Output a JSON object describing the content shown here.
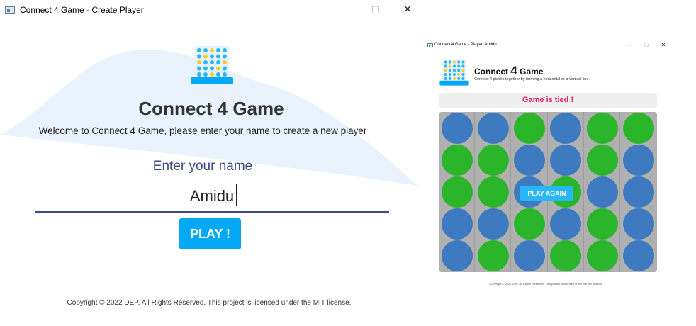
{
  "window1": {
    "title": "Connect 4 Game - Create Player",
    "controls": {
      "minimize": "—",
      "maximize": "☐",
      "close": "✕"
    },
    "heading": "Connect 4 Game",
    "welcome": "Welcome to Connect 4 Game, please enter your name to create a new player",
    "name_label": "Enter your name",
    "name_value": "Amidu",
    "play_label": "PLAY !",
    "copyright": "Copyright © 2022 DEP. All Rights Reserved. This project is licensed under the MIT license.",
    "colors": {
      "accent": "#03a9f4",
      "label": "#3b4a84",
      "wave": "#eaf3fd"
    }
  },
  "window2": {
    "title": "Connect 4 Game - Player: Amidu",
    "controls": {
      "minimize": "—",
      "maximize": "☐",
      "close": "✕"
    },
    "heading_prefix": "Connect ",
    "heading_number": "4",
    "heading_suffix": " Game",
    "subtitle": "Connect 4 pieces together by forming a horizontal or a vertical line.",
    "status": "Game is tied !",
    "play_again_label": "PLAY AGAIN",
    "copyright": "Copyright © 2022 DEP. All Rights Reserved. This project is licensed under the MIT license.",
    "board": [
      [
        "blue",
        "blue",
        "green",
        "blue",
        "green",
        "green"
      ],
      [
        "green",
        "green",
        "blue",
        "blue",
        "green",
        "blue"
      ],
      [
        "green",
        "green",
        "blue",
        "green",
        "blue",
        "blue"
      ],
      [
        "blue",
        "blue",
        "green",
        "blue",
        "green",
        "blue"
      ],
      [
        "blue",
        "green",
        "blue",
        "green",
        "green",
        "blue"
      ]
    ],
    "colors": {
      "blue": "#3d7ac0",
      "green": "#2bb52b",
      "status": "#e91e63"
    }
  }
}
